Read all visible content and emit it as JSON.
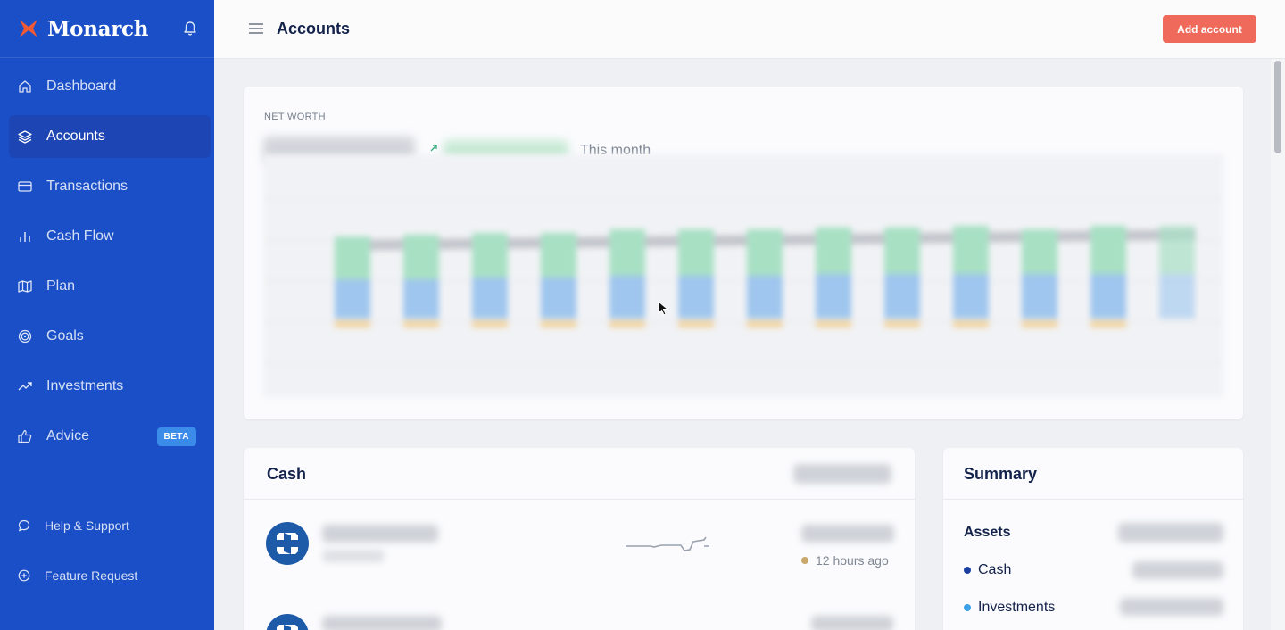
{
  "brand": {
    "name": "Monarch",
    "accent": "#ef5a36"
  },
  "sidebar": {
    "bg": "#1a4fc7",
    "items": [
      {
        "label": "Dashboard",
        "icon": "home-icon",
        "active": false
      },
      {
        "label": "Accounts",
        "icon": "layers-icon",
        "active": true
      },
      {
        "label": "Transactions",
        "icon": "credit-card-icon",
        "active": false
      },
      {
        "label": "Cash Flow",
        "icon": "bar-chart-icon",
        "active": false
      },
      {
        "label": "Plan",
        "icon": "map-icon",
        "active": false
      },
      {
        "label": "Goals",
        "icon": "target-icon",
        "active": false
      },
      {
        "label": "Investments",
        "icon": "trending-up-icon",
        "active": false
      },
      {
        "label": "Advice",
        "icon": "thumbs-up-icon",
        "active": false,
        "badge": "BETA"
      }
    ],
    "footer": [
      {
        "label": "Help & Support",
        "icon": "chat-bubble-icon"
      },
      {
        "label": "Feature Request",
        "icon": "plus-circle-icon"
      }
    ]
  },
  "header": {
    "title": "Accounts",
    "add_button": "Add account"
  },
  "net_worth": {
    "label": "NET WORTH",
    "period": "This month"
  },
  "cash": {
    "title": "Cash",
    "accounts": [
      {
        "updated": "12 hours ago",
        "status_color": "#c9a86a"
      }
    ]
  },
  "summary": {
    "title": "Summary",
    "assets_label": "Assets",
    "rows": [
      {
        "label": "Cash",
        "color": "#1a3fa0"
      },
      {
        "label": "Investments",
        "color": "#3ba1e8"
      }
    ]
  }
}
